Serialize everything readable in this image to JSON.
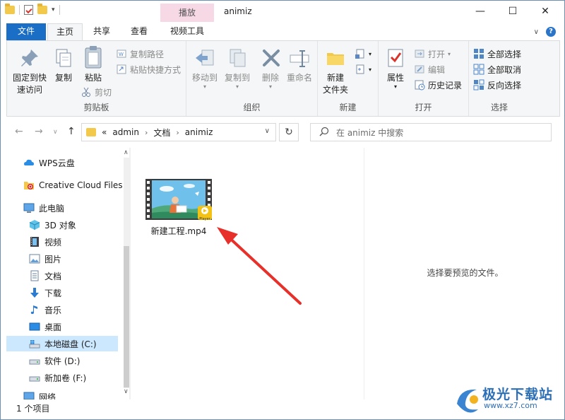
{
  "window": {
    "title": "animiz",
    "contextual_tab_header": "播放",
    "controls": {
      "minimize": "—",
      "maximize": "☐",
      "close": "✕"
    }
  },
  "tabs": [
    {
      "label": "文件"
    },
    {
      "label": "主页"
    },
    {
      "label": "共享"
    },
    {
      "label": "查看"
    },
    {
      "label": "视频工具"
    }
  ],
  "ribbon": {
    "clipboard": {
      "label": "剪贴板",
      "pin": "固定到快\n速访问",
      "copy": "复制",
      "paste": "粘贴",
      "copy_path": "复制路径",
      "paste_shortcut": "粘贴快捷方式",
      "cut": "剪切"
    },
    "organize": {
      "label": "组织",
      "move_to": "移动到",
      "copy_to": "复制到",
      "delete": "删除",
      "rename": "重命名"
    },
    "new": {
      "label": "新建",
      "new_folder": "新建\n文件夹"
    },
    "open": {
      "label": "打开",
      "properties": "属性",
      "open": "打开",
      "edit": "编辑",
      "history": "历史记录"
    },
    "select": {
      "label": "选择",
      "select_all": "全部选择",
      "select_none": "全部取消",
      "invert": "反向选择"
    }
  },
  "address": {
    "prefix": "«",
    "crumbs": [
      "admin",
      "文档",
      "animiz"
    ],
    "sep": "›"
  },
  "search": {
    "placeholder": "在 animiz 中搜索"
  },
  "sidebar": {
    "items": [
      {
        "label": "WPS云盘"
      },
      {
        "label": "Creative Cloud Files"
      },
      {
        "label": "此电脑"
      },
      {
        "label": "3D 对象"
      },
      {
        "label": "视频"
      },
      {
        "label": "图片"
      },
      {
        "label": "文档"
      },
      {
        "label": "下载"
      },
      {
        "label": "音乐"
      },
      {
        "label": "桌面"
      },
      {
        "label": "本地磁盘 (C:)"
      },
      {
        "label": "软件 (D:)"
      },
      {
        "label": "新加卷 (F:)"
      },
      {
        "label": "网络"
      }
    ]
  },
  "file": {
    "name": "新建工程.mp4",
    "badge": "Player"
  },
  "preview": {
    "text": "选择要预览的文件。"
  },
  "status": {
    "text": "1 个项目"
  },
  "watermark": {
    "text": "极光下载站",
    "url": "www.xz7.com"
  },
  "colors": {
    "accent": "#1a6ec5",
    "selection": "#cce8ff",
    "arrow": "#e8302a",
    "context_tab": "#f7d9e6"
  }
}
